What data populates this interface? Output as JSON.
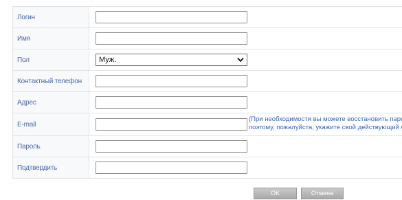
{
  "form": {
    "rows": [
      {
        "label": "Логин",
        "value": ""
      },
      {
        "label": "Имя",
        "value": ""
      },
      {
        "label": "Пол",
        "selected": "Муж."
      },
      {
        "label": "Контактный телефон",
        "value": ""
      },
      {
        "label": "Адрес",
        "value": ""
      },
      {
        "label": "E-mail",
        "value": "",
        "hint_line1": "(При необходимости вы можете восстановить пароль",
        "hint_line2": "поэтому, пожалуйста, укажите свой действующий e-m"
      },
      {
        "label": "Пароль",
        "value": ""
      },
      {
        "label": "Подтвердить",
        "value": ""
      }
    ],
    "buttons": {
      "ok": "OK",
      "cancel": "Отмена"
    }
  },
  "colors": {
    "label_text": "#4a6aa5",
    "hint_text": "#3a63b5",
    "border": "#e3e3e3",
    "button_bg": "#b5b5b5"
  },
  "icons": {
    "select_arrow": "chevron-down-icon"
  }
}
